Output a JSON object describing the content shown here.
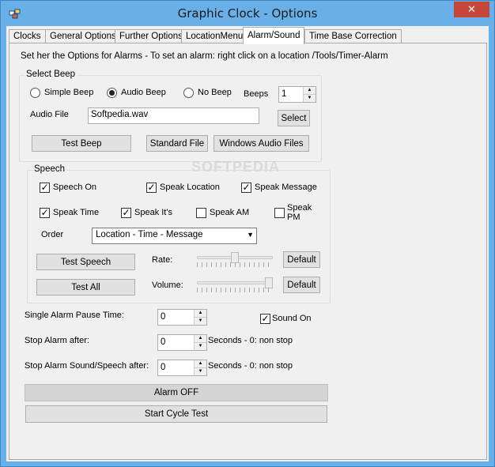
{
  "window": {
    "title": "Graphic Clock - Options",
    "close_glyph": "✕"
  },
  "tabs": [
    {
      "label": "Clocks",
      "active": false
    },
    {
      "label": "General Options",
      "active": false
    },
    {
      "label": "Further Options",
      "active": false
    },
    {
      "label": "LocationMenu",
      "active": false
    },
    {
      "label": "Alarm/Sound",
      "active": true
    },
    {
      "label": "Time Base Correction",
      "active": false
    }
  ],
  "info_text": "Set her the Options for Alarms - To set an alarm: right click on a location /Tools/Timer-Alarm",
  "select_beep": {
    "title": "Select Beep",
    "options": [
      "Simple Beep",
      "Audio Beep",
      "No Beep"
    ],
    "selected": "Audio Beep",
    "beeps_label": "Beeps",
    "beeps_value": "1",
    "audio_file_label": "Audio File",
    "audio_file_value": "Softpedia.wav",
    "select_button": "Select",
    "test_beep_button": "Test Beep",
    "standard_file_button": "Standard File",
    "windows_audio_button": "Windows Audio Files"
  },
  "speech": {
    "title": "Speech",
    "checks": [
      {
        "label": "Speech On",
        "checked": true
      },
      {
        "label": "Speak Location",
        "checked": true
      },
      {
        "label": "Speak Message",
        "checked": true
      },
      {
        "label": "Speak Time",
        "checked": true
      },
      {
        "label": "Speak It's",
        "checked": true
      },
      {
        "label": "Speak AM",
        "checked": false
      },
      {
        "label": "Speak",
        "label2": "PM",
        "checked": false
      }
    ],
    "order_label": "Order",
    "order_value": "Location - Time - Message",
    "test_speech_button": "Test Speech",
    "test_all_button": "Test All",
    "rate_label": "Rate:",
    "volume_label": "Volume:",
    "default_label": "Default",
    "rate_level": 0.5,
    "volume_level": 1.0
  },
  "alarm": {
    "pause_label": "Single Alarm Pause Time:",
    "pause_value": "0",
    "sound_on_label": "Sound On",
    "sound_on_checked": true,
    "stop_after_label": "Stop Alarm after:",
    "stop_after_value": "0",
    "stop_after_hint": "Seconds - 0: non stop",
    "stop_sound_label": "Stop Alarm Sound/Speech after:",
    "stop_sound_value": "0",
    "stop_sound_hint": "Seconds - 0: non stop",
    "alarm_off_button": "Alarm OFF",
    "start_cycle_button": "Start Cycle Test"
  },
  "watermark": "SOFTPEDIA",
  "colors": {
    "titlebar": "#6ab0e8",
    "close": "#c7463a"
  }
}
